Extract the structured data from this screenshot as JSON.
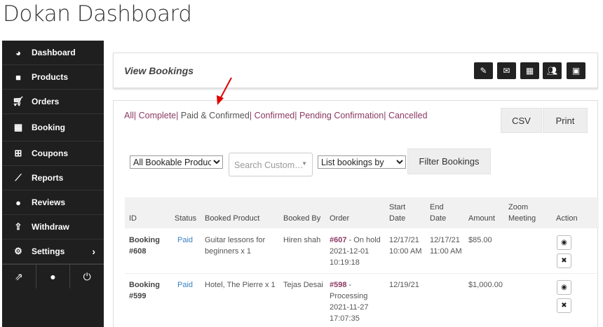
{
  "page": {
    "title": "Dokan Dashboard"
  },
  "sidebar": {
    "items": [
      {
        "label": "Dashboard",
        "icon": "dashboard-icon"
      },
      {
        "label": "Products",
        "icon": "briefcase-icon"
      },
      {
        "label": "Orders",
        "icon": "cart-icon"
      },
      {
        "label": "Booking",
        "icon": "calendar-icon"
      },
      {
        "label": "Coupons",
        "icon": "gift-icon"
      },
      {
        "label": "Reports",
        "icon": "chart-icon"
      },
      {
        "label": "Reviews",
        "icon": "comments-icon"
      },
      {
        "label": "Withdraw",
        "icon": "upload-icon"
      },
      {
        "label": "Settings",
        "icon": "gear-icon"
      }
    ]
  },
  "header": {
    "view_bookings": "View Bookings"
  },
  "filters": {
    "all": "All",
    "complete": "Complete",
    "paid_confirmed": "Paid & Confirmed",
    "confirmed": "Confirmed",
    "pending": "Pending Confirmation",
    "cancelled": "Cancelled",
    "sep": "| "
  },
  "buttons": {
    "csv": "CSV",
    "print": "Print",
    "filter": "Filter Bookings"
  },
  "controls": {
    "product_select": "All Bookable Product",
    "search_placeholder": "Search Custom…",
    "list_by": "List bookings by"
  },
  "table": {
    "headers": {
      "id": "ID",
      "status": "Status",
      "product": "Booked Product",
      "booked_by": "Booked By",
      "order": "Order",
      "start_1": "Start",
      "start_2": "Date",
      "end_1": "End",
      "end_2": "Date",
      "amount": "Amount",
      "zoom_1": "Zoom",
      "zoom_2": "Meeting",
      "action": "Action"
    },
    "rows": [
      {
        "id_1": "Booking",
        "id_2": "#608",
        "status": "Paid",
        "product_1": "Guitar lessons for",
        "product_2": "beginners x 1",
        "booked_by": "Hiren shah",
        "order_num": "#607",
        "order_status": " - On hold",
        "order_date": "2021-12-01",
        "order_time": "10:19:18",
        "start_1": "12/17/21",
        "start_2": "10:00 AM",
        "end_1": "12/17/21",
        "end_2": "11:00 AM",
        "amount": "$85.00"
      },
      {
        "id_1": "Booking",
        "id_2": "#599",
        "status": "Paid",
        "product_1": "Hotel, The Pierre x 1",
        "booked_by": "Tejas Desai",
        "order_num": "#598",
        "order_status": " -",
        "order_status_2": "Processing",
        "order_date": "2021-11-27",
        "order_time": "17:07:35",
        "start_1": "12/19/21",
        "amount": "$1,000.00"
      }
    ]
  },
  "colors": {
    "accent": "#8b3a62",
    "paid": "#3b82c4",
    "sidebar": "#1f1f1f",
    "arrow": "#e00000"
  }
}
